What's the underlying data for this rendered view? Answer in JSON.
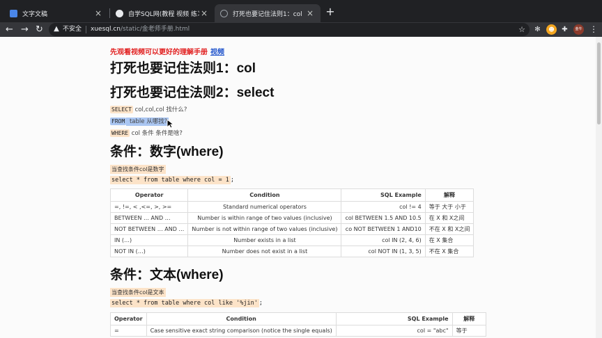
{
  "tabs": [
    {
      "label": "文字文稿",
      "active": false
    },
    {
      "label": "自学SQL网(教程 视频 练习全套)",
      "active": false
    },
    {
      "label": "打死也要记住法则1：col",
      "active": true
    }
  ],
  "toolbar": {
    "security_label": "不安全",
    "url_host": "xuesql.cn",
    "url_path": "/static/金老师手册.html",
    "avatar_text": "金牛"
  },
  "page": {
    "intro_text": "先观看视频可以更好的理解手册",
    "intro_link": "视频",
    "heading1": "打死也要记住法则1：col",
    "heading2": "打死也要记住法则2：select",
    "rules": [
      {
        "kw": "SELECT",
        "text": " col,col,col 找什么?"
      },
      {
        "kw": "FROM",
        "text": "table 从哪找?"
      },
      {
        "kw": "WHERE",
        "text": " col 条件 条件是啥?"
      }
    ],
    "section_number": {
      "title": "条件：数字(where)",
      "note": "当查找条件col是数字",
      "code": "select * from table where col = 1",
      "code_tail": ";",
      "headers": [
        "Operator",
        "Condition",
        "SQL Example",
        "解释"
      ],
      "rows": [
        [
          "=, !=, < ,<=, >, >=",
          "Standard numerical operators",
          "col != 4",
          "等于 大于 小于"
        ],
        [
          "BETWEEN … AND …",
          "Number is within range of two values (inclusive)",
          "col BETWEEN 1.5 AND 10.5",
          "在 X 和 X之间"
        ],
        [
          "NOT BETWEEN … AND …",
          "Number is not within range of two values (inclusive)",
          "co NOT BETWEEN 1 AND10",
          "不在 X 和 X之间"
        ],
        [
          "IN (…)",
          "Number exists in a list",
          "col IN (2, 4, 6)",
          "在 X 集合"
        ],
        [
          "NOT IN (…)",
          "Number does not exist in a list",
          "col NOT IN (1, 3, 5)",
          "不在 X 集合"
        ]
      ]
    },
    "section_text": {
      "title": "条件：文本(where)",
      "note": "当查找条件col是文本",
      "code": "select * from table where col like '%jin'",
      "code_tail": ";",
      "headers": [
        "Operator",
        "Condition",
        "SQL Example",
        "解释"
      ],
      "rows": [
        [
          "=",
          "Case sensitive exact string comparison (notice the single equals)",
          "col = \"abc\"",
          "等于"
        ]
      ]
    }
  }
}
